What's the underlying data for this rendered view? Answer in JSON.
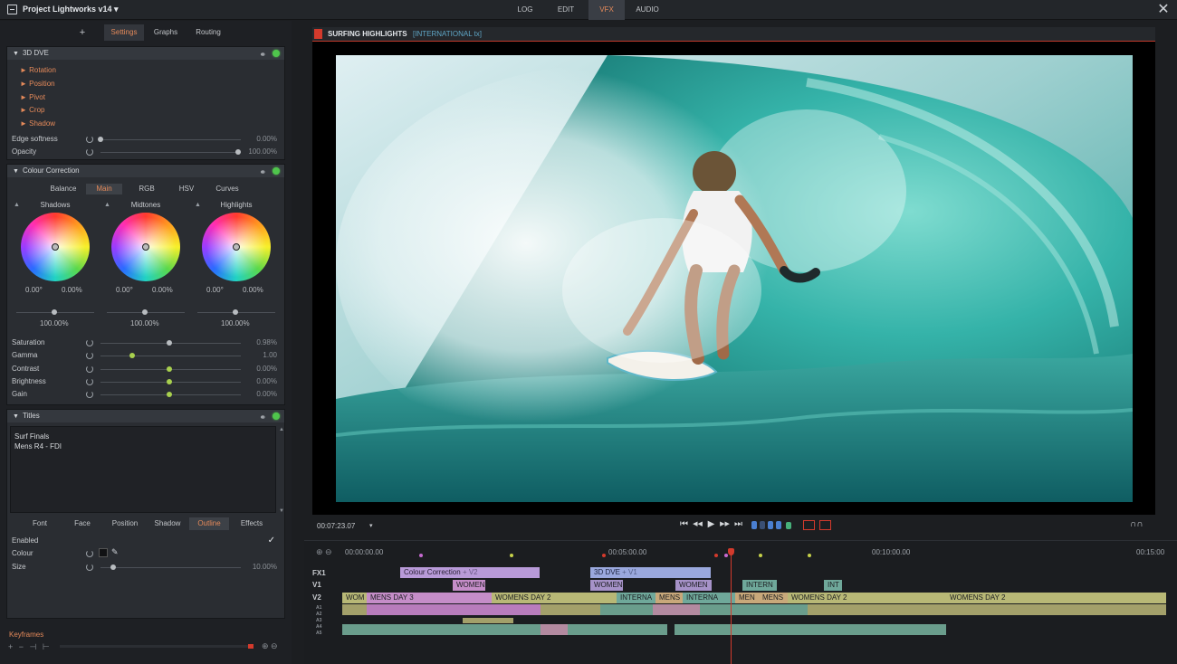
{
  "app": {
    "project_title": "Project Lightworks v14 ▾",
    "close_glyph": "✕"
  },
  "main_tabs": [
    {
      "label": "LOG",
      "active": false
    },
    {
      "label": "EDIT",
      "active": false
    },
    {
      "label": "VFX",
      "active": true
    },
    {
      "label": "AUDIO",
      "active": false
    }
  ],
  "settings_tabs": [
    {
      "label": "+"
    },
    {
      "label": "Settings",
      "active": true
    },
    {
      "label": "Graphs"
    },
    {
      "label": "Routing"
    }
  ],
  "dve": {
    "title": "3D DVE",
    "items": [
      "Rotation",
      "Position",
      "Pivot",
      "Crop",
      "Shadow"
    ],
    "params": [
      {
        "label": "Edge softness",
        "value": "0.00%",
        "fraction": 0.0
      },
      {
        "label": "Opacity",
        "value": "100.00%",
        "fraction": 1.0
      }
    ]
  },
  "colour_correction": {
    "title": "Colour Correction",
    "tabs": [
      "Balance",
      "Main",
      "RGB",
      "HSV",
      "Curves"
    ],
    "active_tab": "Main",
    "wheels": [
      {
        "name": "Shadows",
        "hue": "0.00°",
        "sat": "0.00%",
        "level": "100.00%"
      },
      {
        "name": "Midtones",
        "hue": "0.00°",
        "sat": "0.00%",
        "level": "100.00%"
      },
      {
        "name": "Highlights",
        "hue": "0.00°",
        "sat": "0.00%",
        "level": "100.00%"
      }
    ],
    "params": [
      {
        "label": "Saturation",
        "value": "0.98%",
        "fraction": 0.49
      },
      {
        "label": "Gamma",
        "value": "1.00",
        "fraction": 0.22
      },
      {
        "label": "Contrast",
        "value": "0.00%",
        "fraction": 0.5
      },
      {
        "label": "Brightness",
        "value": "0.00%",
        "fraction": 0.5
      },
      {
        "label": "Gain",
        "value": "0.00%",
        "fraction": 0.5
      }
    ]
  },
  "titles": {
    "title": "Titles",
    "text_lines": [
      "Surf Finals",
      "Mens R4 - FDI"
    ],
    "tabs": [
      "Font",
      "Face",
      "Position",
      "Shadow",
      "Outline",
      "Effects"
    ],
    "active_tab": "Outline",
    "params": [
      {
        "label": "Enabled",
        "value": "✓"
      },
      {
        "label": "Colour",
        "value": ""
      },
      {
        "label": "Size",
        "value": "10.00%",
        "fraction": 0.05
      }
    ]
  },
  "keyframes": {
    "label": "Keyframes"
  },
  "viewer": {
    "clip_title": "SURFING HIGHLIGHTS",
    "clip_subtitle": "[INTERNATIONAL tx]",
    "timecode": "00:07:23.07",
    "timecode_caret": "▾"
  },
  "transport": [
    "⏮",
    "◀◀",
    "▶",
    "▶▶",
    "⏭"
  ],
  "timeline": {
    "ruler": [
      "00:00:00.00",
      "00:05:00.00",
      "00:10:00.00",
      "00:15:00"
    ],
    "tracks": [
      "FX1",
      "V1",
      "V2",
      "A1",
      "A2",
      "A3",
      "A4",
      "A5"
    ],
    "fx_clips": [
      {
        "label": "Colour Correction",
        "tag": "+ V2"
      },
      {
        "label": "3D DVE",
        "tag": "+ V1"
      }
    ],
    "v1_clips": [
      "WOMEN",
      "WOMEN",
      "WOMEN",
      "INTERN",
      "INT"
    ],
    "v2_clips": [
      "WOM",
      "MENS DAY 3",
      "WOMENS DAY 2",
      "INTERNA",
      "MENS",
      "INTERNA",
      "MEN",
      "MENS",
      "WOMENS DAY 2",
      "WOMENS DAY 2"
    ]
  },
  "colors": {
    "accent": "#e58a5a",
    "record": "#d33a2c",
    "active_dot": "#4fc54c",
    "subtitle": "#5fa7c7"
  }
}
